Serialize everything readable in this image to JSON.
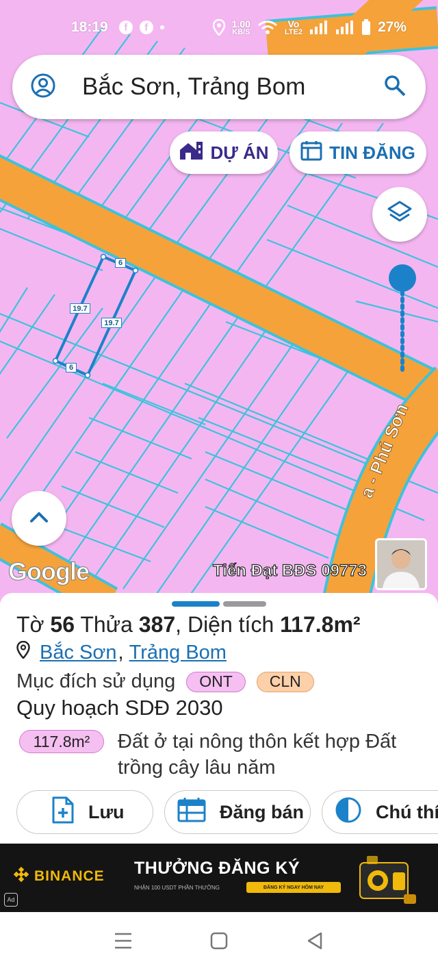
{
  "status_bar": {
    "time": "18:19",
    "net_speed_value": "1.00",
    "net_speed_unit": "KB/S",
    "volte_top": "Vo",
    "volte_bottom": "LTE2",
    "battery": "27%"
  },
  "search": {
    "query": "Bắc Sơn, Trảng Bom"
  },
  "map_buttons": {
    "du_an": "DỰ ÁN",
    "tin_dang": "TIN ĐĂNG"
  },
  "parcel": {
    "side_top": "6",
    "side_bottom": "6",
    "side_left": "19.7",
    "side_right": "19.7"
  },
  "map_text": {
    "google": "Google",
    "road_label": "a - Phú Sơn",
    "watermark": "Tiến Đạt BĐS 09773"
  },
  "sheet": {
    "title_pre": "Tờ ",
    "to_number": "56",
    "title_mid": " Thửa ",
    "thua_number": "387",
    "title_mid2": ", Diện tích ",
    "area": "117.8m²",
    "location_commune": "Bắc Sơn",
    "location_sep": ",",
    "location_district": "Trảng Bom",
    "purpose_label": "Mục đích sử dụng",
    "purpose_chips": [
      "ONT",
      "CLN"
    ],
    "plan_label": "Quy hoạch SDĐ 2030",
    "plan_area": "117.8m²",
    "plan_desc": "Đất ở tại nông thôn kết hợp Đất trồng cây lâu năm",
    "actions": {
      "save": "Lưu",
      "sell": "Đăng bán",
      "legend": "Chú thí"
    }
  },
  "ad": {
    "brand": "BINANCE",
    "title": "THƯỞNG ĐĂNG KÝ",
    "subtitle": "NHẬN 100 USDT PHẦN THƯỞNG",
    "cta": "ĐĂNG KÝ NGAY HÔM NAY",
    "badge": "Ad"
  },
  "colors": {
    "map_zone": "#f4b6f1",
    "road": "#f5a23b",
    "parcel_line": "#3cc3dc",
    "accent": "#1b82c9",
    "brand_purple": "#3a2a8a"
  }
}
